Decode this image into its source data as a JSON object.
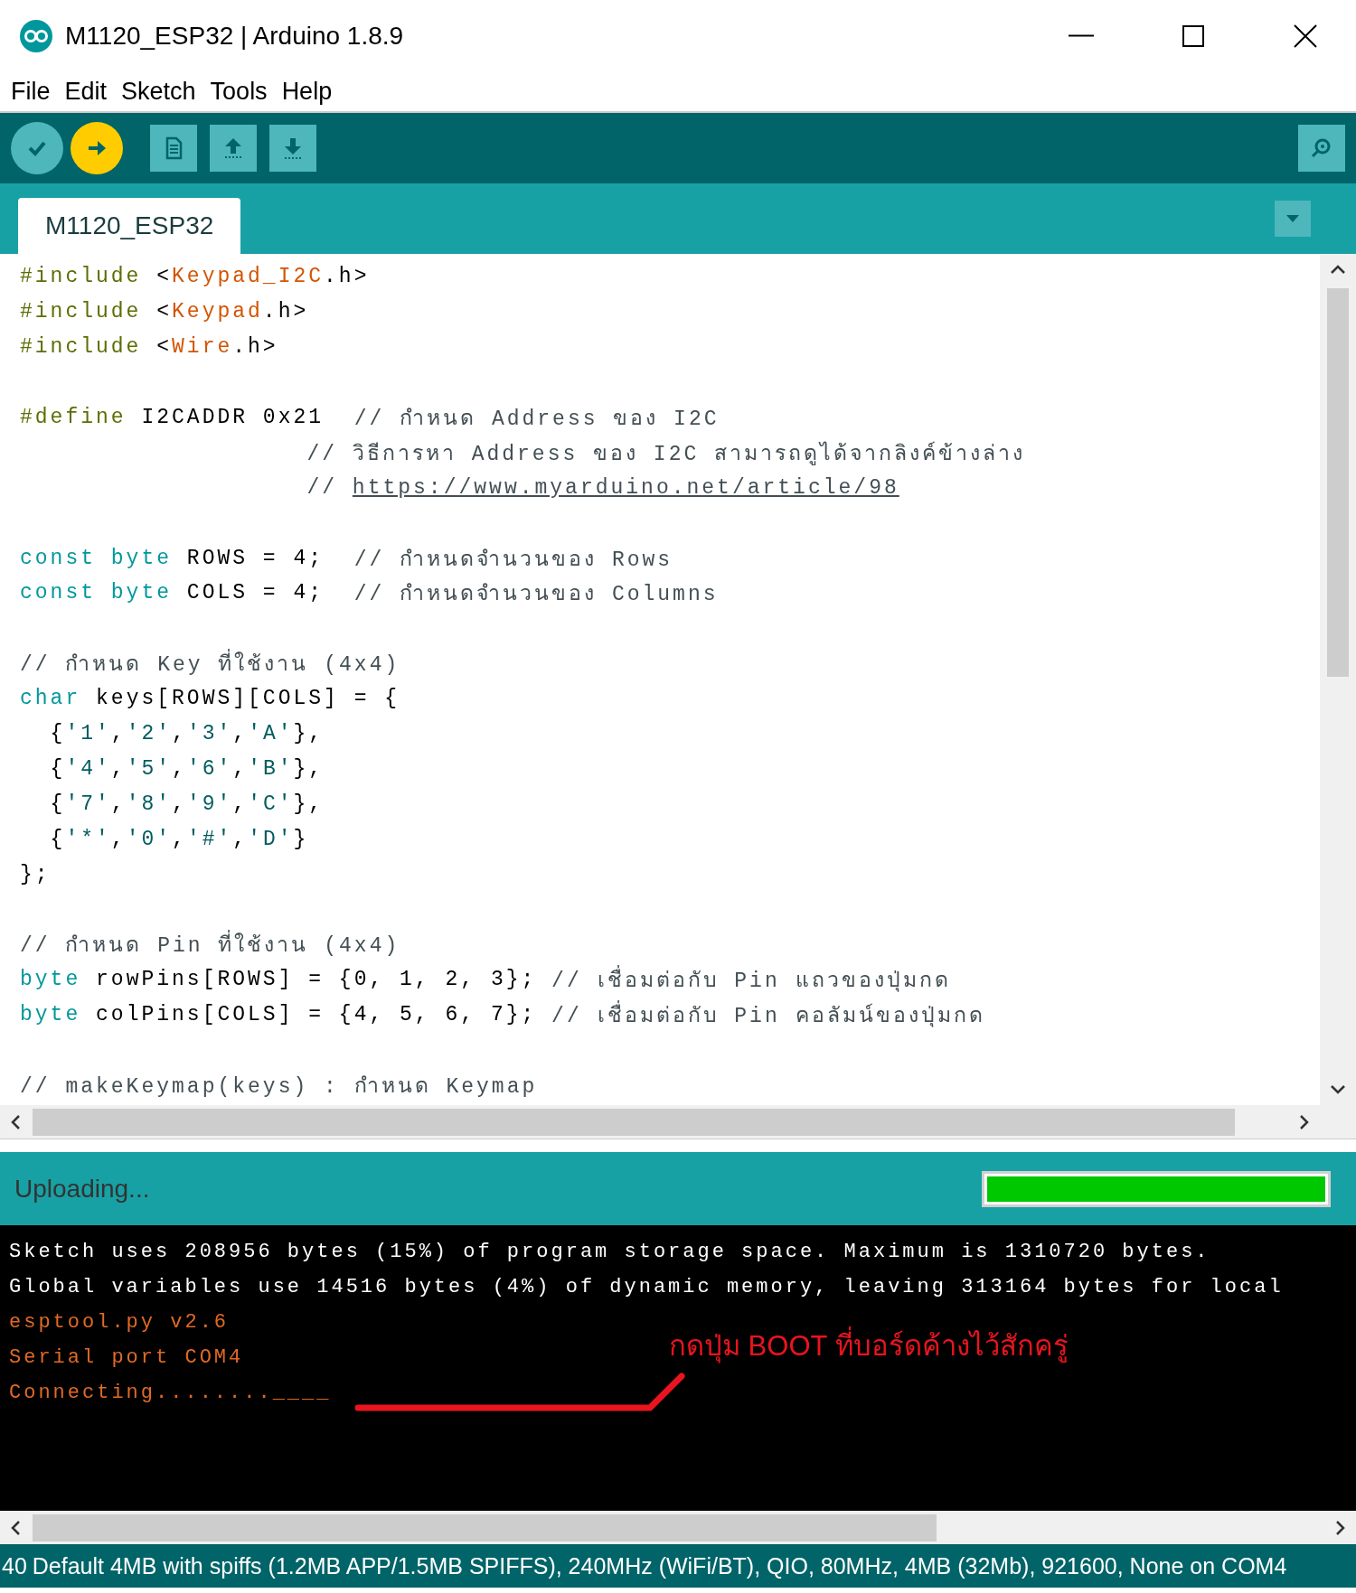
{
  "window": {
    "title": "M1120_ESP32 | Arduino 1.8.9"
  },
  "menu": [
    {
      "label": "File"
    },
    {
      "label": "Edit"
    },
    {
      "label": "Sketch"
    },
    {
      "label": "Tools"
    },
    {
      "label": "Help"
    }
  ],
  "toolbar": [
    {
      "kind": "verify"
    },
    {
      "kind": "upload"
    },
    {
      "kind": "new"
    },
    {
      "kind": "open"
    },
    {
      "kind": "save"
    }
  ],
  "tabs": [
    {
      "label": "M1120_ESP32",
      "selected": true
    }
  ],
  "code": [
    {
      "kind": "code",
      "tokens": [
        {
          "t": "#include",
          "kind": "pp"
        },
        {
          "t": " <",
          "kind": "plain"
        },
        {
          "t": "Keypad_I2C",
          "kind": "lib"
        },
        {
          "t": ".h>",
          "kind": "plain"
        }
      ]
    },
    {
      "kind": "code",
      "tokens": [
        {
          "t": "#include",
          "kind": "pp"
        },
        {
          "t": " <",
          "kind": "plain"
        },
        {
          "t": "Keypad",
          "kind": "lib"
        },
        {
          "t": ".h>",
          "kind": "plain"
        }
      ]
    },
    {
      "kind": "code",
      "tokens": [
        {
          "t": "#include",
          "kind": "pp"
        },
        {
          "t": " <",
          "kind": "plain"
        },
        {
          "t": "Wire",
          "kind": "lib"
        },
        {
          "t": ".h>",
          "kind": "plain"
        }
      ]
    },
    {
      "kind": "blank"
    },
    {
      "kind": "code",
      "tokens": [
        {
          "t": "#define",
          "kind": "pp"
        },
        {
          "t": " I2CADDR 0x21  ",
          "kind": "plain"
        },
        {
          "t": "// กำหนด Address ของ I2C",
          "kind": "cmt"
        }
      ]
    },
    {
      "kind": "aligned",
      "tokens": [
        {
          "t": "// วิธีการหา Address ของ I2C สามารถดูได้จากลิงค์ข้างล่าง",
          "kind": "cmt"
        }
      ]
    },
    {
      "kind": "aligned",
      "tokens": [
        {
          "t": "// ",
          "kind": "cmt"
        },
        {
          "t": "https://www.myarduino.net/article/98",
          "kind": "link"
        }
      ]
    },
    {
      "kind": "blank"
    },
    {
      "kind": "code",
      "tokens": [
        {
          "t": "const byte",
          "kind": "type"
        },
        {
          "t": " ROWS = 4;  ",
          "kind": "plain"
        },
        {
          "t": "// กำหนดจำนวนของ Rows",
          "kind": "cmt"
        }
      ]
    },
    {
      "kind": "code",
      "tokens": [
        {
          "t": "const byte",
          "kind": "type"
        },
        {
          "t": " COLS = 4;  ",
          "kind": "plain"
        },
        {
          "t": "// กำหนดจำนวนของ Columns",
          "kind": "cmt"
        }
      ]
    },
    {
      "kind": "blank"
    },
    {
      "kind": "code",
      "tokens": [
        {
          "t": "// กำหนด Key ที่ใช้งาน (4x4)",
          "kind": "cmt"
        }
      ]
    },
    {
      "kind": "code",
      "tokens": [
        {
          "t": "char",
          "kind": "type"
        },
        {
          "t": " keys[ROWS][COLS] = {",
          "kind": "plain"
        }
      ]
    },
    {
      "kind": "code",
      "tokens": [
        {
          "t": "  {",
          "kind": "plain"
        },
        {
          "t": "'1'",
          "kind": "str"
        },
        {
          "t": ",",
          "kind": "plain"
        },
        {
          "t": "'2'",
          "kind": "str"
        },
        {
          "t": ",",
          "kind": "plain"
        },
        {
          "t": "'3'",
          "kind": "str"
        },
        {
          "t": ",",
          "kind": "plain"
        },
        {
          "t": "'A'",
          "kind": "str"
        },
        {
          "t": "},",
          "kind": "plain"
        }
      ]
    },
    {
      "kind": "code",
      "tokens": [
        {
          "t": "  {",
          "kind": "plain"
        },
        {
          "t": "'4'",
          "kind": "str"
        },
        {
          "t": ",",
          "kind": "plain"
        },
        {
          "t": "'5'",
          "kind": "str"
        },
        {
          "t": ",",
          "kind": "plain"
        },
        {
          "t": "'6'",
          "kind": "str"
        },
        {
          "t": ",",
          "kind": "plain"
        },
        {
          "t": "'B'",
          "kind": "str"
        },
        {
          "t": "},",
          "kind": "plain"
        }
      ]
    },
    {
      "kind": "code",
      "tokens": [
        {
          "t": "  {",
          "kind": "plain"
        },
        {
          "t": "'7'",
          "kind": "str"
        },
        {
          "t": ",",
          "kind": "plain"
        },
        {
          "t": "'8'",
          "kind": "str"
        },
        {
          "t": ",",
          "kind": "plain"
        },
        {
          "t": "'9'",
          "kind": "str"
        },
        {
          "t": ",",
          "kind": "plain"
        },
        {
          "t": "'C'",
          "kind": "str"
        },
        {
          "t": "},",
          "kind": "plain"
        }
      ]
    },
    {
      "kind": "code",
      "tokens": [
        {
          "t": "  {",
          "kind": "plain"
        },
        {
          "t": "'*'",
          "kind": "str"
        },
        {
          "t": ",",
          "kind": "plain"
        },
        {
          "t": "'0'",
          "kind": "str"
        },
        {
          "t": ",",
          "kind": "plain"
        },
        {
          "t": "'#'",
          "kind": "str"
        },
        {
          "t": ",",
          "kind": "plain"
        },
        {
          "t": "'D'",
          "kind": "str"
        },
        {
          "t": "}",
          "kind": "plain"
        }
      ]
    },
    {
      "kind": "code",
      "tokens": [
        {
          "t": "};",
          "kind": "plain"
        }
      ]
    },
    {
      "kind": "blank"
    },
    {
      "kind": "code",
      "tokens": [
        {
          "t": "// กำหนด Pin ที่ใช้งาน (4x4)",
          "kind": "cmt"
        }
      ]
    },
    {
      "kind": "code",
      "tokens": [
        {
          "t": "byte",
          "kind": "type"
        },
        {
          "t": " rowPins[ROWS] = {0, 1, 2, 3}; ",
          "kind": "plain"
        },
        {
          "t": "// เชื่อมต่อกับ Pin แถวของปุ่มกด",
          "kind": "cmt"
        }
      ]
    },
    {
      "kind": "code",
      "tokens": [
        {
          "t": "byte",
          "kind": "type"
        },
        {
          "t": " colPins[COLS] = {4, 5, 6, 7}; ",
          "kind": "plain"
        },
        {
          "t": "// เชื่อมต่อกับ Pin คอลัมน์ของปุ่มกด",
          "kind": "cmt"
        }
      ]
    },
    {
      "kind": "blank"
    },
    {
      "kind": "code",
      "tokens": [
        {
          "t": "// makeKeymap(keys) : กำหนด Keymap",
          "kind": "cmt"
        }
      ]
    }
  ],
  "upload_status": {
    "label": "Uploading...",
    "level": 1
  },
  "console": [
    {
      "text": "Sketch uses 208956 bytes (15%) of program storage space. Maximum is 1310720 bytes.",
      "kind": "info"
    },
    {
      "text": "Global variables use 14516 bytes (4%) of dynamic memory, leaving 313164 bytes for local",
      "kind": "info"
    },
    {
      "text": "esptool.py v2.6",
      "kind": "tool"
    },
    {
      "text": "Serial port COM4",
      "kind": "tool"
    },
    {
      "text": "Connecting........____",
      "kind": "tool"
    }
  ],
  "annotation": {
    "text": "กดปุ่ม BOOT ที่บอร์ดค้างไว้สักครู่"
  },
  "status_bar": {
    "line": "40",
    "board": "Default 4MB with spiffs (1.2MB APP/1.5MB SPIFFS), 240MHz (WiFi/BT), QIO, 80MHz, 4MB (32Mb), 921600, None on COM4"
  }
}
